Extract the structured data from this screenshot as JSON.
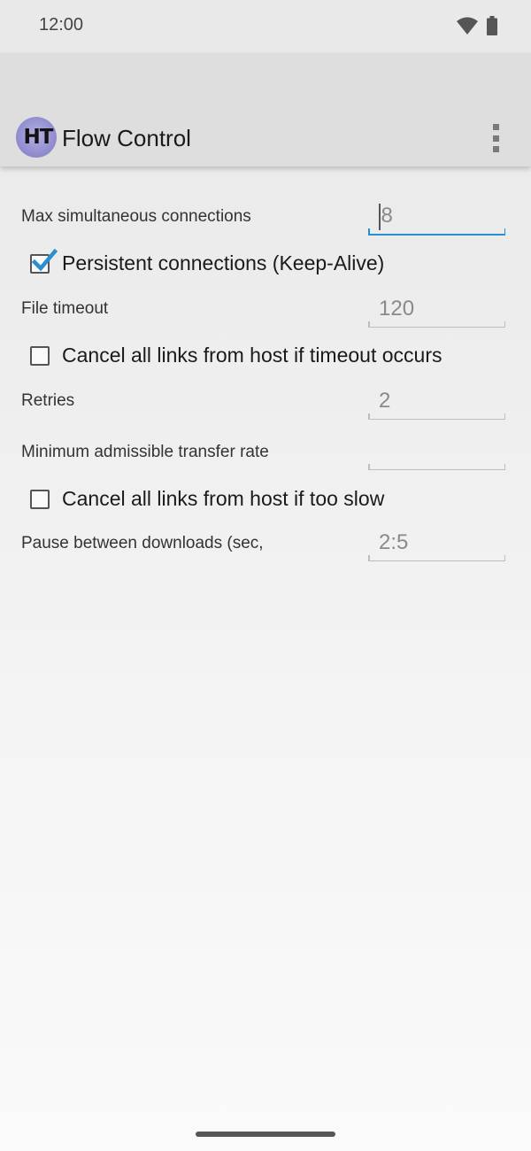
{
  "status_bar": {
    "time": "12:00"
  },
  "app_bar": {
    "logo_text": "HT",
    "title": "Flow Control"
  },
  "settings": {
    "max_connections": {
      "label": "Max simultaneous connections",
      "value": "8"
    },
    "keep_alive": {
      "label": "Persistent connections (Keep-Alive)",
      "checked": true
    },
    "file_timeout": {
      "label": "File timeout",
      "value": "120"
    },
    "cancel_timeout": {
      "label": "Cancel all links from host if timeout occurs",
      "checked": false
    },
    "retries": {
      "label": "Retries",
      "value": "2"
    },
    "min_rate": {
      "label": "Minimum admissible transfer rate",
      "value": ""
    },
    "cancel_slow": {
      "label": "Cancel all links from host if too slow",
      "checked": false
    },
    "pause": {
      "label": "Pause between downloads (sec, MIN:MAX)",
      "value": "2:5"
    }
  },
  "colors": {
    "accent": "#2a8fd0",
    "checkmark": "#2a8fd0"
  }
}
